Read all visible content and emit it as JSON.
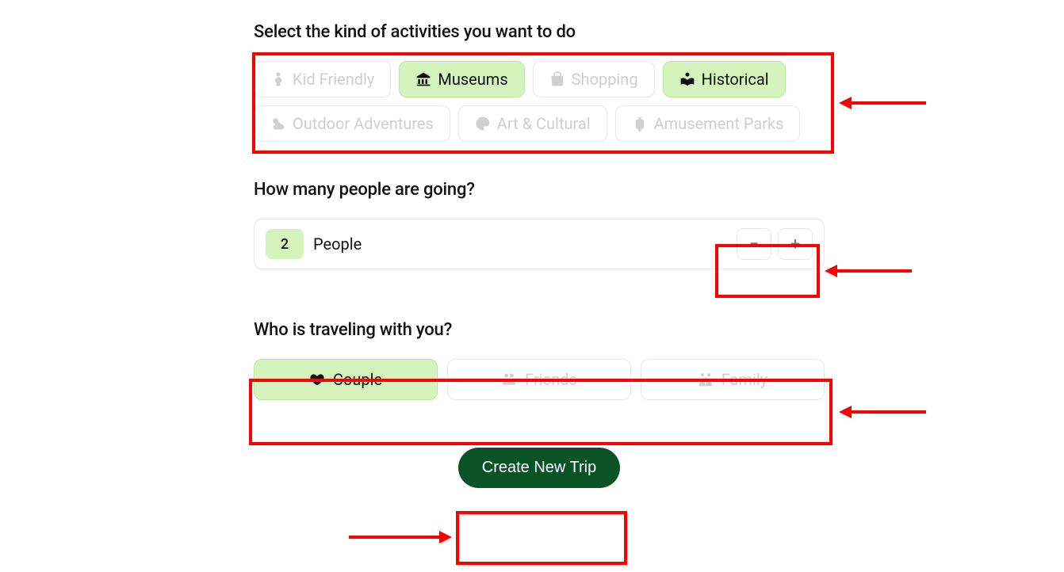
{
  "activities": {
    "title": "Select the kind of activities you want to do",
    "items": [
      {
        "label": "Kid Friendly",
        "icon": "child-icon",
        "selected": false
      },
      {
        "label": "Museums",
        "icon": "museum-icon",
        "selected": true
      },
      {
        "label": "Shopping",
        "icon": "shopping-bag-icon",
        "selected": false
      },
      {
        "label": "Historical",
        "icon": "book-reader-icon",
        "selected": true
      },
      {
        "label": "Outdoor Adventures",
        "icon": "cloud-sun-icon",
        "selected": false
      },
      {
        "label": "Art & Cultural",
        "icon": "palette-icon",
        "selected": false
      },
      {
        "label": "Amusement Parks",
        "icon": "ticket-icon",
        "selected": false
      }
    ]
  },
  "people": {
    "title": "How many people are going?",
    "count": "2",
    "unit": "People",
    "minus": "−",
    "plus": "+"
  },
  "companions": {
    "title": "Who is traveling with you?",
    "items": [
      {
        "label": "Couple",
        "icon": "heart-icon",
        "selected": true
      },
      {
        "label": "Friends",
        "icon": "friends-icon",
        "selected": false
      },
      {
        "label": "Family",
        "icon": "family-icon",
        "selected": false
      }
    ]
  },
  "cta": {
    "label": "Create New Trip"
  }
}
